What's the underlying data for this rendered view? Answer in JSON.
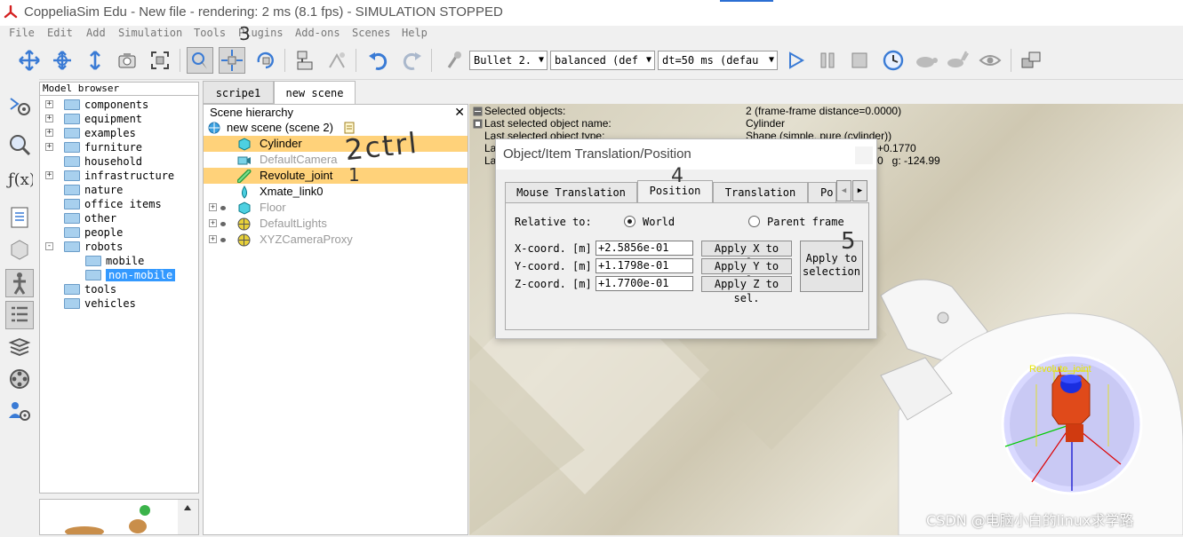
{
  "window": {
    "title": "CoppeliaSim Edu - New file - rendering: 2 ms (8.1 fps) - SIMULATION STOPPED"
  },
  "menu": [
    "File",
    "Edit",
    "Add",
    "Simulation",
    "Tools",
    "Plugins",
    "Add-ons",
    "Scenes",
    "Help"
  ],
  "toolbar": {
    "engine": "Bullet 2.",
    "accuracy": "balanced (def",
    "dt": "dt=50 ms (defau"
  },
  "model_browser": {
    "header": "Model browser",
    "items": [
      {
        "label": "components",
        "expander": "+"
      },
      {
        "label": "equipment",
        "expander": "+"
      },
      {
        "label": "examples",
        "expander": "+"
      },
      {
        "label": "furniture",
        "expander": "+"
      },
      {
        "label": "household",
        "expander": ""
      },
      {
        "label": "infrastructure",
        "expander": "+"
      },
      {
        "label": "nature",
        "expander": ""
      },
      {
        "label": "office items",
        "expander": ""
      },
      {
        "label": "other",
        "expander": ""
      },
      {
        "label": "people",
        "expander": ""
      },
      {
        "label": "robots",
        "expander": "-"
      },
      {
        "label": "mobile",
        "expander": ""
      },
      {
        "label": "non-mobile",
        "expander": ""
      },
      {
        "label": "tools",
        "expander": ""
      },
      {
        "label": "vehicles",
        "expander": ""
      }
    ]
  },
  "scene_tabs": [
    "scripe1",
    "new scene"
  ],
  "scene_hierarchy": {
    "header": "Scene hierarchy",
    "root": "new scene (scene 2)",
    "items": [
      "Cylinder",
      "DefaultCamera",
      "Revolute_joint",
      "Xmate_link0",
      "Floor",
      "DefaultLights",
      "XYZCameraProxy"
    ]
  },
  "info": {
    "selected_label": "Selected objects:",
    "selected_value": "2 (frame-frame distance=0.0000)",
    "last_name_label": "Last selected object name:",
    "last_name_value": "Cylinder",
    "last_type_label": "Last selected object type:",
    "last_type_value": "Shape (simple, pure (cylinder))",
    "row4_label": "La",
    "row4_value": "+0.1770",
    "row5_label": "La",
    "row5_value": "0   g: -124.99"
  },
  "dialog": {
    "title": "Object/Item Translation/Position",
    "tabs": [
      "Mouse Translation",
      "Position",
      "Translation",
      "Po"
    ],
    "relative_to": "Relative to:",
    "world": "World",
    "parent_frame": "Parent frame",
    "x_label": "X-coord. [m]",
    "y_label": "Y-coord. [m]",
    "z_label": "Z-coord. [m]",
    "x_value": "+2.5856e-01",
    "y_value": "+1.1798e-01",
    "z_value": "+1.7700e-01",
    "apply_x": "Apply X to sel.",
    "apply_y": "Apply Y to sel.",
    "apply_z": "Apply Z to sel.",
    "apply_selection": "Apply to selection"
  },
  "annotations": {
    "a1": "1",
    "a2": "2ctrl",
    "a3": "3",
    "a4": "4",
    "a5": "5"
  },
  "viewport_label": "Revolute_joint",
  "watermark": "CSDN @电脑小白的linux求学路"
}
